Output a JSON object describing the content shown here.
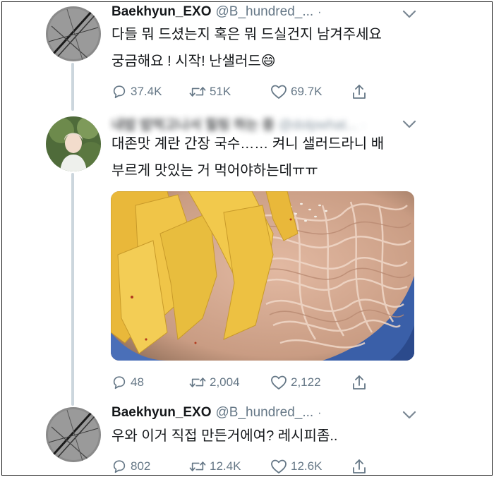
{
  "tweets": [
    {
      "name": "Baekhyun_EXO",
      "handle": "@B_hundred_...",
      "dot": "·",
      "text_lines": [
        "다들 뭐 드셨는지 혹은 뭐 드실건지 남겨주세요",
        "궁금해요 ! 시작! 난샐러드😄"
      ],
      "replies": "37.4K",
      "retweets": "51K",
      "likes": "69.7K"
    },
    {
      "name": "내밥 밥먹고나서 힐링 하는 중",
      "handle": "@dolpwhat...",
      "dot": "·",
      "text_lines": [
        "대존맛 계란 간장 국수…… 켜니 샐러드라니 배",
        "부르게 맛있는 거 먹어야하는데ㅠㅠ"
      ],
      "replies": "48",
      "retweets": "2,004",
      "likes": "2,122"
    },
    {
      "name": "Baekhyun_EXO",
      "handle": "@B_hundred_...",
      "dot": "·",
      "text_lines": [
        "우와 이거 직접 만든거에여? 레시피좀.."
      ],
      "replies": "802",
      "retweets": "12.4K",
      "likes": "12.6K"
    }
  ],
  "icons": {
    "reply": "reply-icon",
    "retweet": "retweet-icon",
    "like": "heart-icon",
    "share": "share-icon",
    "menu": "chevron-down-icon"
  },
  "colors": {
    "text": "#14171a",
    "secondary": "#657786",
    "thread_line": "#ccd6dd"
  }
}
